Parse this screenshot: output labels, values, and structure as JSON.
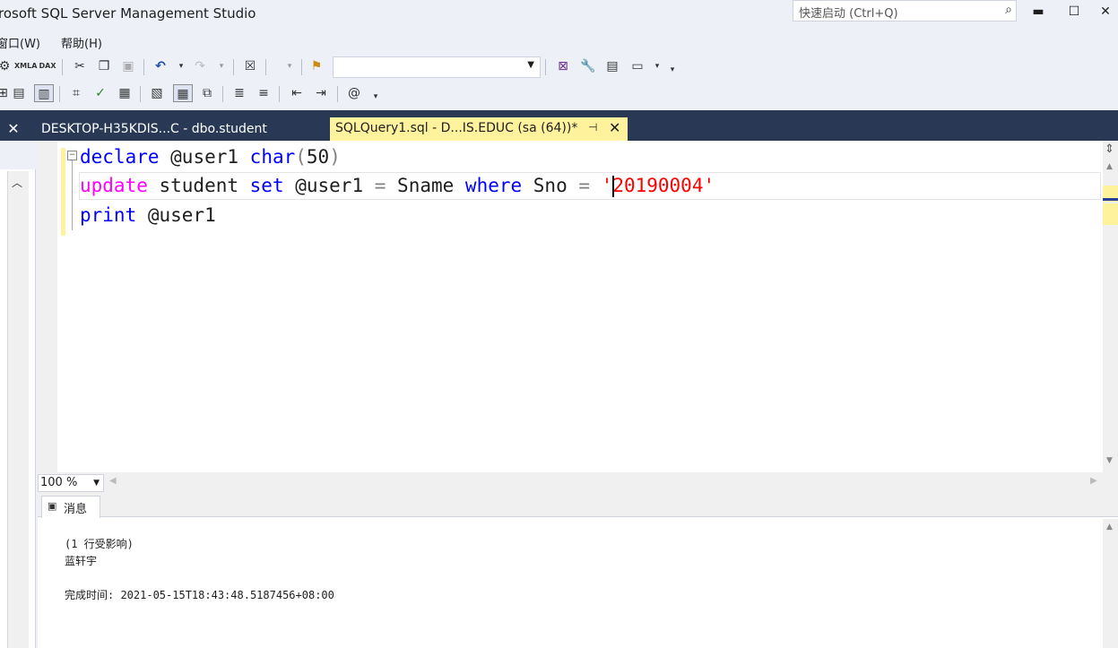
{
  "window": {
    "title": "rosoft SQL Server Management Studio",
    "quick_launch_placeholder": "快速启动 (Ctrl+Q)",
    "minimize": "▬",
    "maximize": "☐",
    "close": "✕"
  },
  "menu": {
    "items": [
      "窗口(W)",
      "帮助(H)"
    ]
  },
  "toolbar1": {
    "xmla_label": "XMLA",
    "dax_label": "DAX",
    "database_combo_value": ""
  },
  "tabs": {
    "left_close": "✕",
    "tab1_label": "DESKTOP-H35KDIS...C - dbo.student",
    "tab2_label": "SQLQuery1.sql - D...IS.EDUC (sa (64))*",
    "tab2_pin": "⊣",
    "tab2_close": "✕"
  },
  "editor": {
    "line1": {
      "kw1": "declare",
      "var": " @user1 ",
      "kw2": "char",
      "paren_open": "(",
      "num": "50",
      "paren_close": ")"
    },
    "line2": {
      "kw1": "update",
      "t1": " student ",
      "kw2": "set",
      "t2": " @user1 ",
      "eq1": "=",
      "t3": " Sname ",
      "kw3": "where",
      "t4": " Sno ",
      "eq2": "=",
      "sp": " ",
      "q1": "'",
      "str": "20190004",
      "q2": "'"
    },
    "line3": {
      "kw1": "print",
      "t1": " @user1"
    }
  },
  "zoom": {
    "value": "100 %"
  },
  "results": {
    "tab_label": "消息",
    "lines": [
      "(1 行受影响)",
      "蓝轩宇",
      "",
      "完成时间: 2021-05-15T18:43:48.5187456+08:00"
    ]
  }
}
